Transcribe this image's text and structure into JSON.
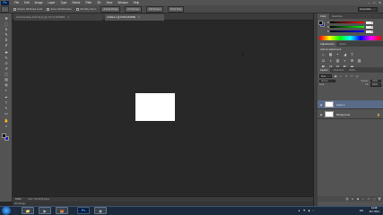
{
  "app": {
    "logo": "Ps",
    "menu": [
      "File",
      "Edit",
      "Image",
      "Layer",
      "Type",
      "Select",
      "Filter",
      "3D",
      "View",
      "Window",
      "Help"
    ],
    "window_controls": [
      "–",
      "□",
      "✕"
    ]
  },
  "options_bar": {
    "checkboxes": [
      "Resize Windows to Fit",
      "Zoom All Windows",
      "Scrubby Zoom"
    ],
    "buttons": [
      "Actual Pixels",
      "Fit Screen",
      "Fill Screen",
      "Print Size"
    ],
    "workspace": "Essentials"
  },
  "tabs": [
    {
      "label": "sfondi-desktop-2014-hd.jpg @ 16.7% (RGB/8#)"
    },
    {
      "label": "Untitled-1 @ 100% (RGB/8)"
    }
  ],
  "tab_close": "×",
  "tools": {
    "icons": [
      "move-icon",
      "marquee-icon",
      "lasso-icon",
      "quick-select-icon",
      "crop-icon",
      "eyedropper-icon",
      "healing-icon",
      "brush-icon",
      "clone-stamp-icon",
      "history-brush-icon",
      "eraser-icon",
      "gradient-icon",
      "blur-icon",
      "dodge-icon",
      "pen-icon",
      "type-icon",
      "path-select-icon",
      "shape-icon",
      "hand-icon",
      "zoom-icon"
    ],
    "glyphs": [
      "✥",
      "⬚",
      "ꝺ",
      "✎",
      "⌗",
      "✐",
      "✚",
      "✎",
      "⊙",
      "↺",
      "◻",
      "▤",
      "◍",
      "◐",
      "✒",
      "T",
      "↖",
      "▭",
      "✋",
      "⌕"
    ],
    "foreground": "#000000",
    "background": "#1c1cc4"
  },
  "canvas": {
    "document_color": "#ffffff",
    "cursor_glyph": "↖"
  },
  "status": {
    "zoom": "100%",
    "doc_info": "Doc: 791.0K/0 bytes",
    "mini_bridge": "Mini Bridge"
  },
  "color_panel": {
    "tabs": [
      "Color",
      "Swatches"
    ],
    "sliders": [
      {
        "label": "R",
        "value": "0"
      },
      {
        "label": "G",
        "value": "0"
      },
      {
        "label": "B",
        "value": "0"
      }
    ]
  },
  "adjustments_panel": {
    "tabs": [
      "Adjustments",
      "Styles"
    ],
    "title": "Add an adjustment",
    "row1": [
      "☼",
      "▦",
      "◓",
      "◢",
      "▽"
    ],
    "row2": [
      "⚖",
      "◑",
      "▥",
      "◐",
      "⊞",
      "▨"
    ],
    "row3": [
      "◩",
      "◪",
      "▤",
      "◧",
      "▣"
    ]
  },
  "layers_panel": {
    "tabs": [
      "Layers",
      "Channels",
      "Paths"
    ],
    "kind": "Kind",
    "filter_icons": [
      "▣",
      "◐",
      "T",
      "▭",
      "◫"
    ],
    "blend_mode": "Normal",
    "opacity_label": "Opacity:",
    "opacity": "100%",
    "lock_label": "Lock:",
    "fill_label": "Fill:",
    "fill": "100%",
    "layers": [
      {
        "name": "Layer 1",
        "visible": "◉",
        "lock": ""
      },
      {
        "name": "Background",
        "visible": "◉",
        "lock": "🔒"
      }
    ],
    "footer_icons": [
      "⛓",
      "fx",
      "◙",
      "◐",
      "▭",
      "▢",
      "🗑"
    ]
  },
  "taskbar": {
    "apps": [
      {
        "name": "file-explorer-icon",
        "glyph": "📁"
      },
      {
        "name": "media-player-icon",
        "glyph": "▶"
      },
      {
        "name": "firefox-icon",
        "glyph": "🦊"
      },
      {
        "name": "photoshop-taskbar-icon",
        "glyph": "Ps"
      },
      {
        "name": "chrome-icon",
        "glyph": "◉"
      }
    ],
    "language": "EN",
    "tray_icons": [
      "▲",
      "⚑",
      "▮",
      "♪"
    ],
    "time": "13:08",
    "date": "30.7.2014"
  }
}
